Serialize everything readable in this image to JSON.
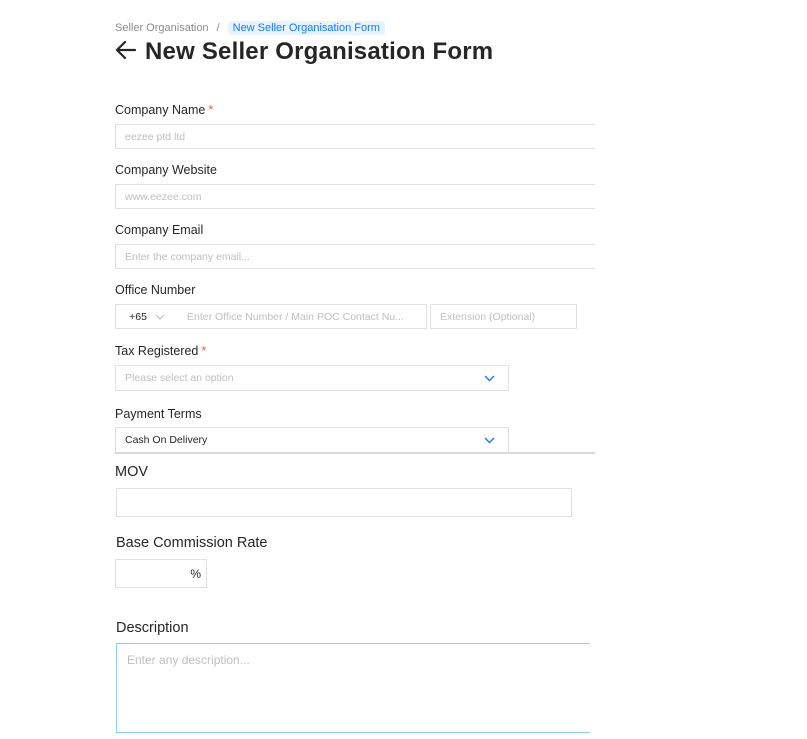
{
  "breadcrumb": {
    "parent": "Seller Organisation",
    "separator": "/",
    "current": "New Seller Organisation Form"
  },
  "page": {
    "back_icon": "arrow-left-icon",
    "title": "New Seller Organisation Form"
  },
  "form": {
    "company_name": {
      "label": "Company Name",
      "required_mark": "*",
      "placeholder": "eezee ptd ltd"
    },
    "company_website": {
      "label": "Company Website",
      "placeholder": "www.eezee.com"
    },
    "company_email": {
      "label": "Company Email",
      "placeholder": "Enter the company email..."
    },
    "office_number": {
      "label": "Office Number",
      "country_code": "+65",
      "number_placeholder": "Enter Office Number / Main POC Contact Nu...",
      "extension_placeholder": "Extension (Optional)"
    },
    "tax_registered": {
      "label": "Tax Registered",
      "required_mark": "*",
      "placeholder": "Please select an option"
    },
    "payment_terms": {
      "label": "Payment Terms",
      "value": "Cash On Delivery"
    },
    "mov": {
      "label": "MOV",
      "value": ""
    },
    "base_commission_rate": {
      "label": "Base Commission Rate",
      "value": "",
      "suffix": "%"
    },
    "description": {
      "label": "Description",
      "placeholder": "Enter any description..."
    }
  },
  "colors": {
    "accent": "#1677ff",
    "required": "#ff4d4f",
    "border": "#e0e0e0",
    "focus_border": "#91caff"
  }
}
